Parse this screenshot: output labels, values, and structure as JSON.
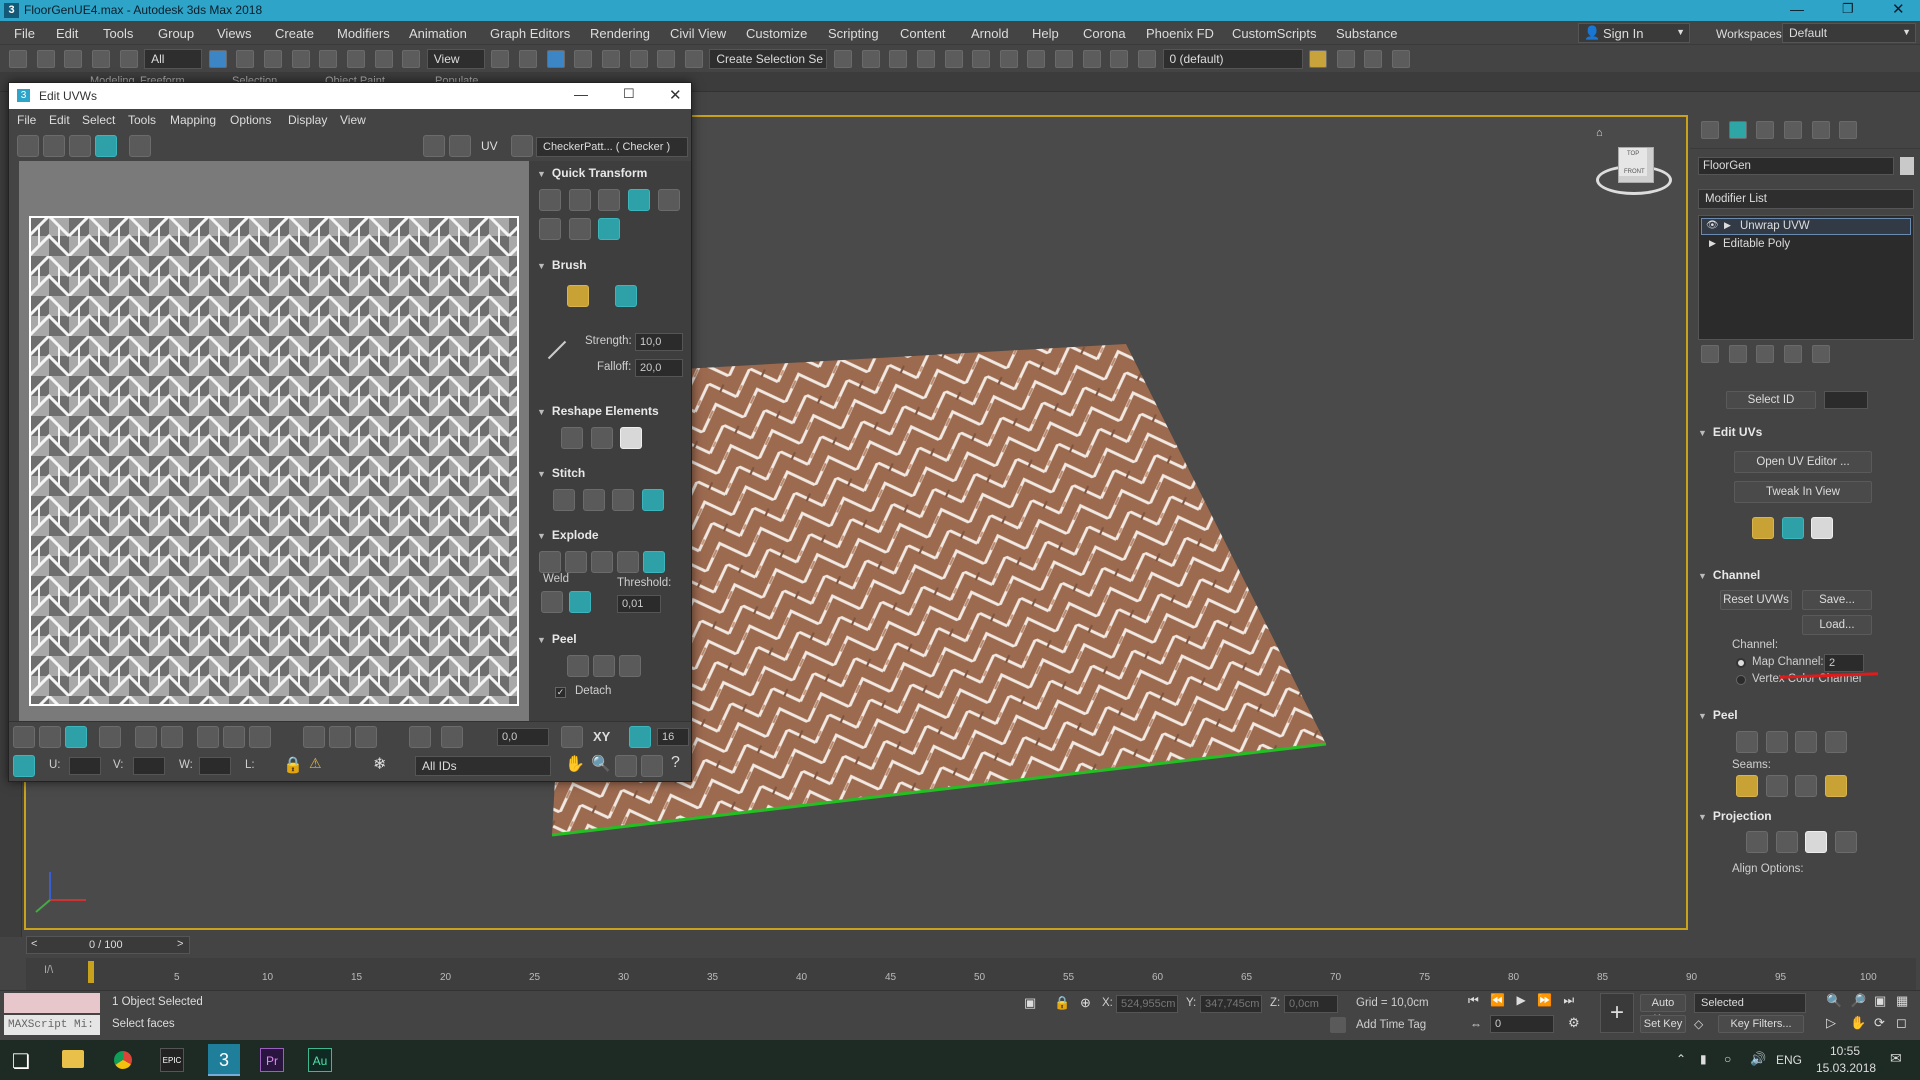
{
  "title_bar": {
    "title": "FloorGenUE4.max - Autodesk 3ds Max 2018"
  },
  "menu": {
    "items": [
      "File",
      "Edit",
      "Tools",
      "Group",
      "Views",
      "Create",
      "Modifiers",
      "Animation",
      "Graph Editors",
      "Rendering",
      "Civil View",
      "Customize",
      "Scripting",
      "Content",
      "Arnold",
      "Help",
      "Corona",
      "Phoenix FD",
      "CustomScripts",
      "Substance"
    ],
    "sign_in": "Sign In",
    "workspaces_label": "Workspaces:",
    "workspace_value": "Default"
  },
  "toolbar": {
    "selection_filter": "All",
    "ref_coord": "View",
    "create_selection_set": "Create Selection Se",
    "layer": "0 (default)"
  },
  "ribbon_tabs": [
    "Modeling",
    "Freeform",
    "Selection",
    "Object Paint",
    "Populate"
  ],
  "uv_editor": {
    "title": "Edit UVWs",
    "menu": [
      "File",
      "Edit",
      "Select",
      "Tools",
      "Mapping",
      "Options",
      "Display",
      "View"
    ],
    "uv_label": "UV",
    "checker_dropdown": "CheckerPatt... ( Checker )",
    "sections": {
      "quick_transform": "Quick Transform",
      "brush": "Brush",
      "strength_label": "Strength:",
      "strength_value": "10,0",
      "falloff_label": "Falloff:",
      "falloff_value": "20,0",
      "reshape": "Reshape Elements",
      "stitch": "Stitch",
      "explode": "Explode",
      "weld_label": "Weld",
      "threshold_label": "Threshold:",
      "threshold_value": "0,01",
      "peel": "Peel",
      "detach_label": "Detach"
    },
    "bottom": {
      "rotate_value": "0,0",
      "xy_label": "XY",
      "pixels_value": "16",
      "u_label": "U:",
      "v_label": "V:",
      "w_label": "W:",
      "l_label": "L:",
      "ids_dropdown": "All IDs"
    }
  },
  "command_panel": {
    "object_name": "FloorGen",
    "modifier_list": "Modifier List",
    "stack": [
      "Unwrap UVW",
      "Editable Poly"
    ],
    "select_id": "Select ID",
    "edit_uvs": "Edit UVs",
    "open_uv_editor": "Open UV Editor ...",
    "tweak_in_view": "Tweak In View",
    "channel_section": "Channel",
    "reset_uvws": "Reset UVWs",
    "save": "Save...",
    "load": "Load...",
    "channel_label": "Channel:",
    "map_channel_label": "Map Channel:",
    "map_channel_value": "2",
    "vertex_color_channel": "Vertex Color Channel",
    "peel_section": "Peel",
    "seams_label": "Seams:",
    "projection_section": "Projection",
    "align_options": "Align Options:"
  },
  "timeline": {
    "frame_counter": "0 / 100",
    "ticks": [
      "5",
      "10",
      "15",
      "20",
      "25",
      "30",
      "35",
      "40",
      "45",
      "50",
      "55",
      "60",
      "65",
      "70",
      "75",
      "80",
      "85",
      "90",
      "95",
      "100"
    ]
  },
  "status": {
    "maxscript": "MAXScript Mi:",
    "objects_selected": "1 Object Selected",
    "prompt": "Select faces",
    "x_label": "X:",
    "x_value": "524,955cm",
    "y_label": "Y:",
    "y_value": "347,745cm",
    "z_label": "Z:",
    "z_value": "0,0cm",
    "grid": "Grid = 10,0cm",
    "add_time_tag": "Add Time Tag",
    "auto_key": "Auto Key",
    "set_key": "Set Key",
    "selected_dropdown": "Selected",
    "key_filters": "Key Filters...",
    "frame_value": "0"
  },
  "viewcube": {
    "face_top": "TOP",
    "face_front": "FRONT"
  },
  "taskbar": {
    "epic_label": "EPIC",
    "max_label": "3",
    "pr_label": "Pr",
    "au_label": "Au",
    "lang": "ENG",
    "time": "10:55",
    "date": "15.03.2018"
  },
  "colors": {
    "accent_teal": "#2ea0a8",
    "selection_green": "#22c022",
    "wood": "#9b6a4f",
    "title_blue": "#2ea4c8"
  }
}
